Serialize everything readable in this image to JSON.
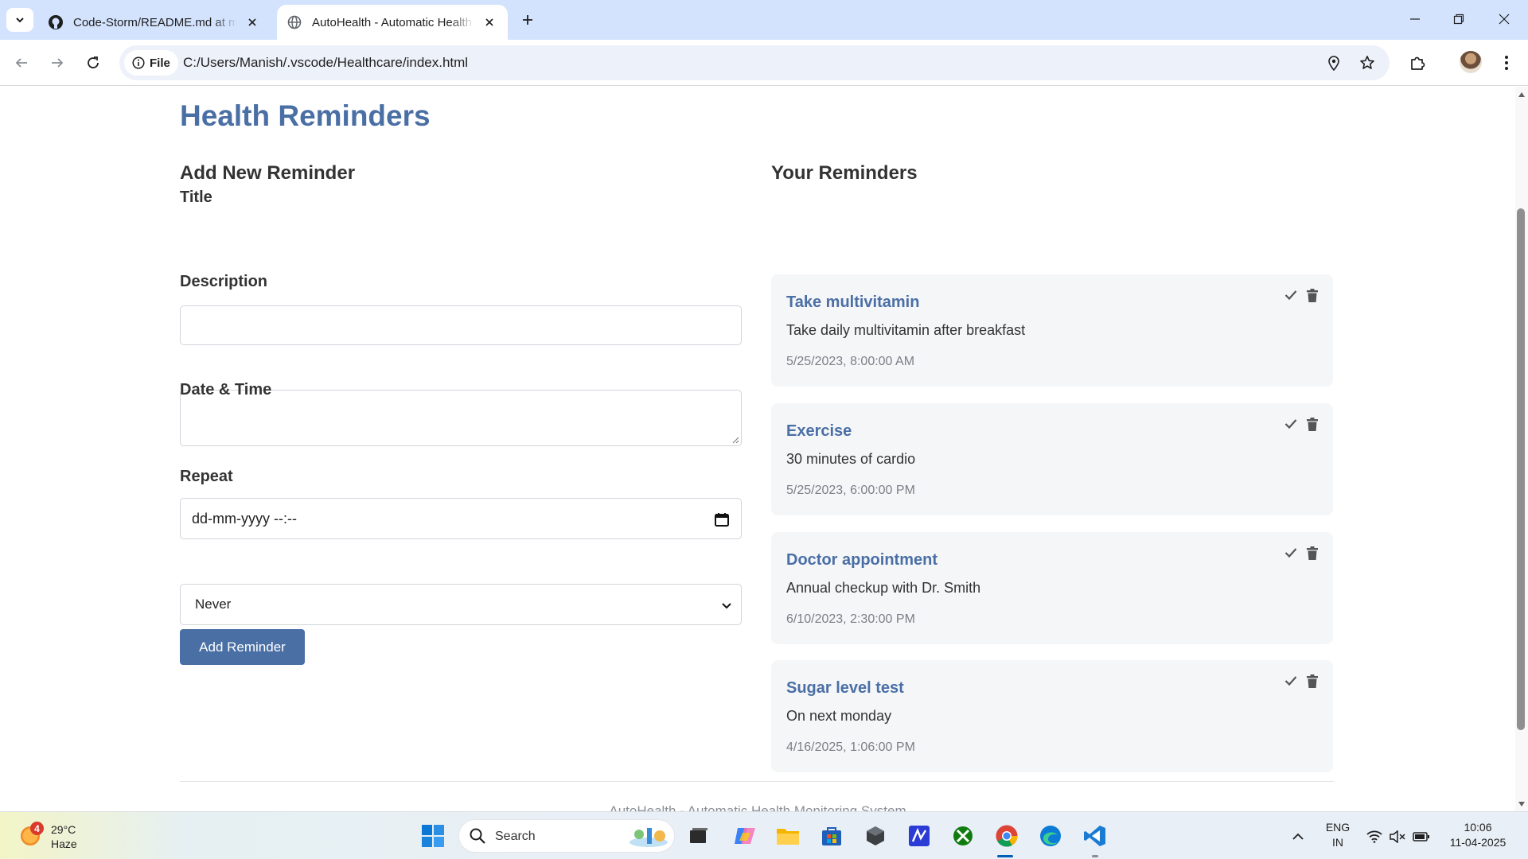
{
  "browser": {
    "tabs": [
      {
        "title": "Code-Storm/README.md at main",
        "favicon": "github-icon",
        "active": false
      },
      {
        "title": "AutoHealth - Automatic Health Monitoring System",
        "favicon": "globe-icon",
        "active": true
      }
    ],
    "address": {
      "chip_label": "File",
      "url": "C:/Users/Manish/.vscode/Healthcare/index.html"
    }
  },
  "page": {
    "title": "Health Reminders",
    "form": {
      "heading": "Add New Reminder",
      "title_label": "Title",
      "title_value": "",
      "description_label": "Description",
      "description_value": "",
      "datetime_label": "Date & Time",
      "datetime_placeholder": "dd-mm-yyyy --:--",
      "repeat_label": "Repeat",
      "repeat_selected": "Never",
      "submit_label": "Add Reminder"
    },
    "list": {
      "heading": "Your Reminders",
      "reminders": [
        {
          "title": "Take multivitamin",
          "description": "Take daily multivitamin after breakfast",
          "datetime": "5/25/2023, 8:00:00 AM"
        },
        {
          "title": "Exercise",
          "description": "30 minutes of cardio",
          "datetime": "5/25/2023, 6:00:00 PM"
        },
        {
          "title": "Doctor appointment",
          "description": "Annual checkup with Dr. Smith",
          "datetime": "6/10/2023, 2:30:00 PM"
        },
        {
          "title": "Sugar level test",
          "description": "On next monday",
          "datetime": "4/16/2025, 1:06:00 PM"
        }
      ]
    },
    "footer_text": "AutoHealth - Automatic Health Monitoring System"
  },
  "taskbar": {
    "weather": {
      "temp": "29°C",
      "condition": "Haze",
      "badge": "4"
    },
    "search_label": "Search",
    "tray": {
      "lang_top": "ENG",
      "lang_bottom": "IN",
      "time": "10:06",
      "date": "11-04-2025"
    }
  },
  "colors": {
    "accent": "#4a6fa5",
    "tabbar": "#d3e3fd",
    "card_bg": "#f5f6f8"
  }
}
